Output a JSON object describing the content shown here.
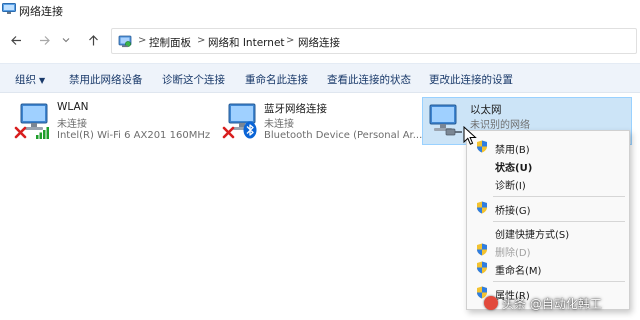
{
  "window": {
    "title": "网络连接",
    "icon": "network-connections-icon"
  },
  "nav": {
    "back_icon": "arrow-left-icon",
    "forward_icon": "arrow-right-icon",
    "recent_icon": "chevron-down-icon",
    "up_icon": "arrow-up-icon"
  },
  "breadcrumb": {
    "items": [
      "控制面板",
      "网络和 Internet",
      "网络连接"
    ],
    "separator": ">"
  },
  "toolbar": {
    "organize": "组织",
    "items": [
      "禁用此网络设备",
      "诊断这个连接",
      "重命名此连接",
      "查看此连接的状态",
      "更改此连接的设置"
    ]
  },
  "connections": [
    {
      "name": "WLAN",
      "status": "未连接",
      "device": "Intel(R) Wi-Fi 6 AX201 160MHz",
      "badge": "red-x-icon",
      "overlay": "wifi-signal-icon"
    },
    {
      "name": "蓝牙网络连接",
      "status": "未连接",
      "device": "Bluetooth Device (Personal Ar...",
      "badge": "red-x-icon",
      "overlay": "bluetooth-icon"
    },
    {
      "name": "以太网",
      "status": "未识别的网络",
      "device": "",
      "overlay": "ethernet-cable-icon",
      "selected": true
    }
  ],
  "context_menu": {
    "items": [
      {
        "label": "禁用(B)",
        "shield": true
      },
      {
        "label": "状态(U)",
        "bold": true
      },
      {
        "label": "诊断(I)"
      },
      {
        "label": "桥接(G)",
        "shield": true
      },
      {
        "label": "创建快捷方式(S)"
      },
      {
        "label": "删除(D)",
        "shield": true,
        "disabled": true
      },
      {
        "label": "重命名(M)",
        "shield": true
      },
      {
        "label": "属性(R)",
        "shield": true
      }
    ]
  },
  "watermark": {
    "text": "头条 @自动化韩工"
  },
  "colors": {
    "toolbar_bg": "#eef3fa",
    "toolbar_text": "#1a3a6a",
    "selection_bg": "#cce4f7",
    "selection_border": "#99d1ff",
    "secondary_text": "#6d6d6d",
    "error_red": "#d81e1e",
    "wifi_green": "#1e9e2a",
    "bluetooth_blue": "#0a64d6"
  }
}
